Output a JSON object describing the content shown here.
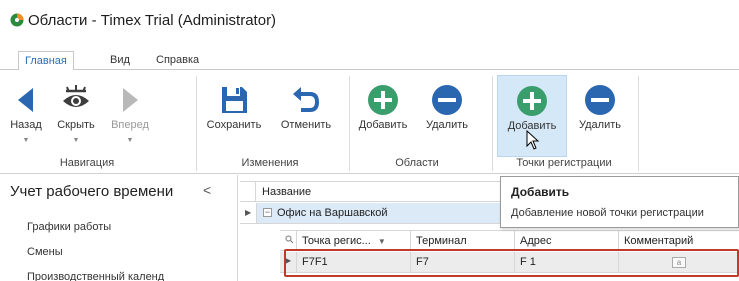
{
  "window": {
    "title": "Области - Timex Trial (Administrator)"
  },
  "tabs": [
    {
      "label": "Главная",
      "active": true
    },
    {
      "label": "Вид",
      "active": false
    },
    {
      "label": "Справка",
      "active": false
    }
  ],
  "ribbon": {
    "buttons": {
      "back": "Назад",
      "hide": "Скрыть",
      "forward": "Вперед",
      "save": "Сохранить",
      "cancel": "Отменить",
      "area_add": "Добавить",
      "area_delete": "Удалить",
      "point_add": "Добавить",
      "point_delete": "Удалить"
    },
    "groups": {
      "navigation": "Навигация",
      "changes": "Изменения",
      "areas": "Области",
      "points": "Точки регистрации"
    }
  },
  "nav": {
    "header": "Учет рабочего времени",
    "collapse_glyph": "<",
    "items": [
      {
        "label": "Графики работы"
      },
      {
        "label": "Смены"
      },
      {
        "label": "Производственный календ"
      }
    ]
  },
  "grid": {
    "column_name": "Название",
    "group_row": "Офис на Варшавской",
    "detail_columns": {
      "point": "Точка регис...",
      "terminal": "Терминал",
      "address": "Адрес",
      "comment": "Комментарий"
    },
    "detail_row": {
      "point": "F7F1",
      "terminal": "F7",
      "address": "F 1",
      "comment_icon": "a"
    }
  },
  "tooltip": {
    "title": "Добавить",
    "text": "Добавление новой точки регистрации"
  },
  "icons": {
    "app": "app-logo-icon",
    "back": "arrow-left-icon",
    "hide": "eye-slash-icon",
    "forward": "arrow-right-icon",
    "save": "floppy-disk-icon",
    "cancel": "undo-icon",
    "add": "plus-circle-icon",
    "delete": "minus-circle-icon"
  },
  "colors": {
    "accent": "#2b6fb6",
    "add_green": "#3a9e6c",
    "delete_blue": "#2b67b1",
    "highlight": "#c0392b",
    "selected_row": "#dce9f7"
  }
}
